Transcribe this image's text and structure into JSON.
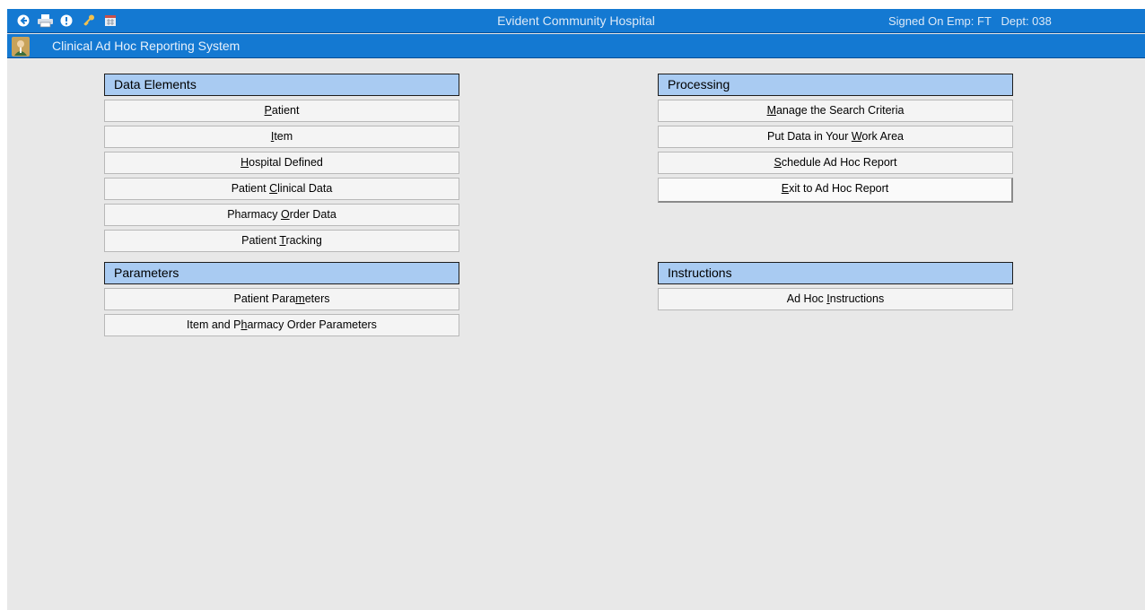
{
  "header": {
    "hospital": "Evident Community Hospital",
    "signed_on": "Signed On Emp: FT   Dept: 038",
    "app_title": "Clinical Ad Hoc Reporting System",
    "toolbar_icons": [
      "back-arrow-icon",
      "printer-icon",
      "info-alert-icon",
      "key-icon",
      "calendar-icon"
    ]
  },
  "sections": {
    "data_elements": {
      "title": "Data Elements",
      "items": [
        {
          "pre": "",
          "u": "P",
          "post": "atient"
        },
        {
          "pre": "",
          "u": "I",
          "post": "tem"
        },
        {
          "pre": "",
          "u": "H",
          "post": "ospital Defined"
        },
        {
          "pre": "Patient ",
          "u": "C",
          "post": "linical Data"
        },
        {
          "pre": "Pharmacy ",
          "u": "O",
          "post": "rder Data"
        },
        {
          "pre": "Patient ",
          "u": "T",
          "post": "racking"
        }
      ]
    },
    "parameters": {
      "title": "Parameters",
      "items": [
        {
          "pre": "Patient Para",
          "u": "m",
          "post": "eters"
        },
        {
          "pre": "Item and P",
          "u": "h",
          "post": "armacy Order Parameters"
        }
      ]
    },
    "processing": {
      "title": "Processing",
      "items": [
        {
          "pre": "",
          "u": "M",
          "post": "anage the Search Criteria"
        },
        {
          "pre": "Put Data in Your ",
          "u": "W",
          "post": "ork Area"
        },
        {
          "pre": "",
          "u": "S",
          "post": "chedule Ad Hoc Report"
        },
        {
          "pre": "",
          "u": "E",
          "post": "xit to Ad Hoc Report"
        }
      ]
    },
    "instructions": {
      "title": "Instructions",
      "items": [
        {
          "pre": "Ad Hoc ",
          "u": "I",
          "post": "nstructions"
        }
      ]
    }
  },
  "colors": {
    "bar_blue": "#1479d2",
    "header_blue": "#a9cbf2",
    "background": "#e8e8e8"
  }
}
